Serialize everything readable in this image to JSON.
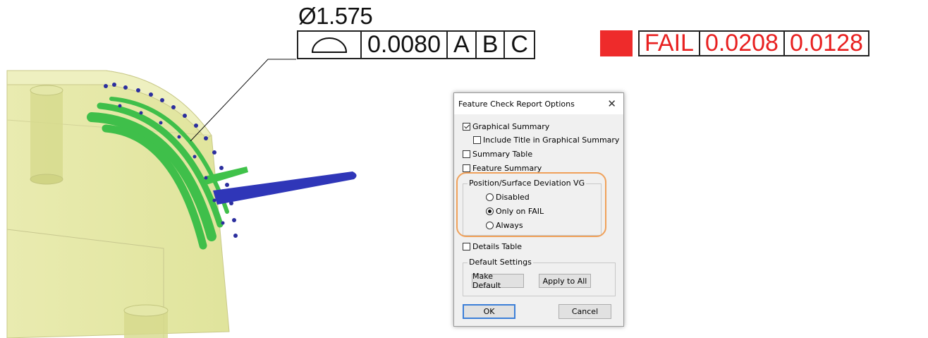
{
  "callout": {
    "diameter_symbol": "Ø",
    "diameter_value": "1.575",
    "profile_symbol": "surface-profile-icon",
    "tolerance": "0.0080",
    "datums": [
      "A",
      "B",
      "C"
    ],
    "result_status": "FAIL",
    "result_values": [
      "0.0208",
      "0.0128"
    ],
    "result_color": "#ee2b2b"
  },
  "dialog": {
    "title": "Feature Check Report Options",
    "close_glyph": "✕",
    "graphical_summary": {
      "label": "Graphical Summary",
      "checked": true
    },
    "include_title": {
      "label": "Include Title in Graphical Summary",
      "checked": false
    },
    "summary_table": {
      "label": "Summary Table",
      "checked": false
    },
    "feature_summary": {
      "label": "Feature Summary",
      "checked": false
    },
    "deviation_group": {
      "label": "Position/Surface Deviation VG",
      "options": [
        "Disabled",
        "Only on FAIL",
        "Always"
      ],
      "selected": "Only on FAIL"
    },
    "details_table": {
      "label": "Details Table",
      "checked": false
    },
    "default_settings": {
      "label": "Default Settings",
      "make_default": "Make Default",
      "apply_to_all": "Apply to All"
    },
    "ok": "OK",
    "cancel": "Cancel"
  },
  "highlight_color": "#f0a15a"
}
